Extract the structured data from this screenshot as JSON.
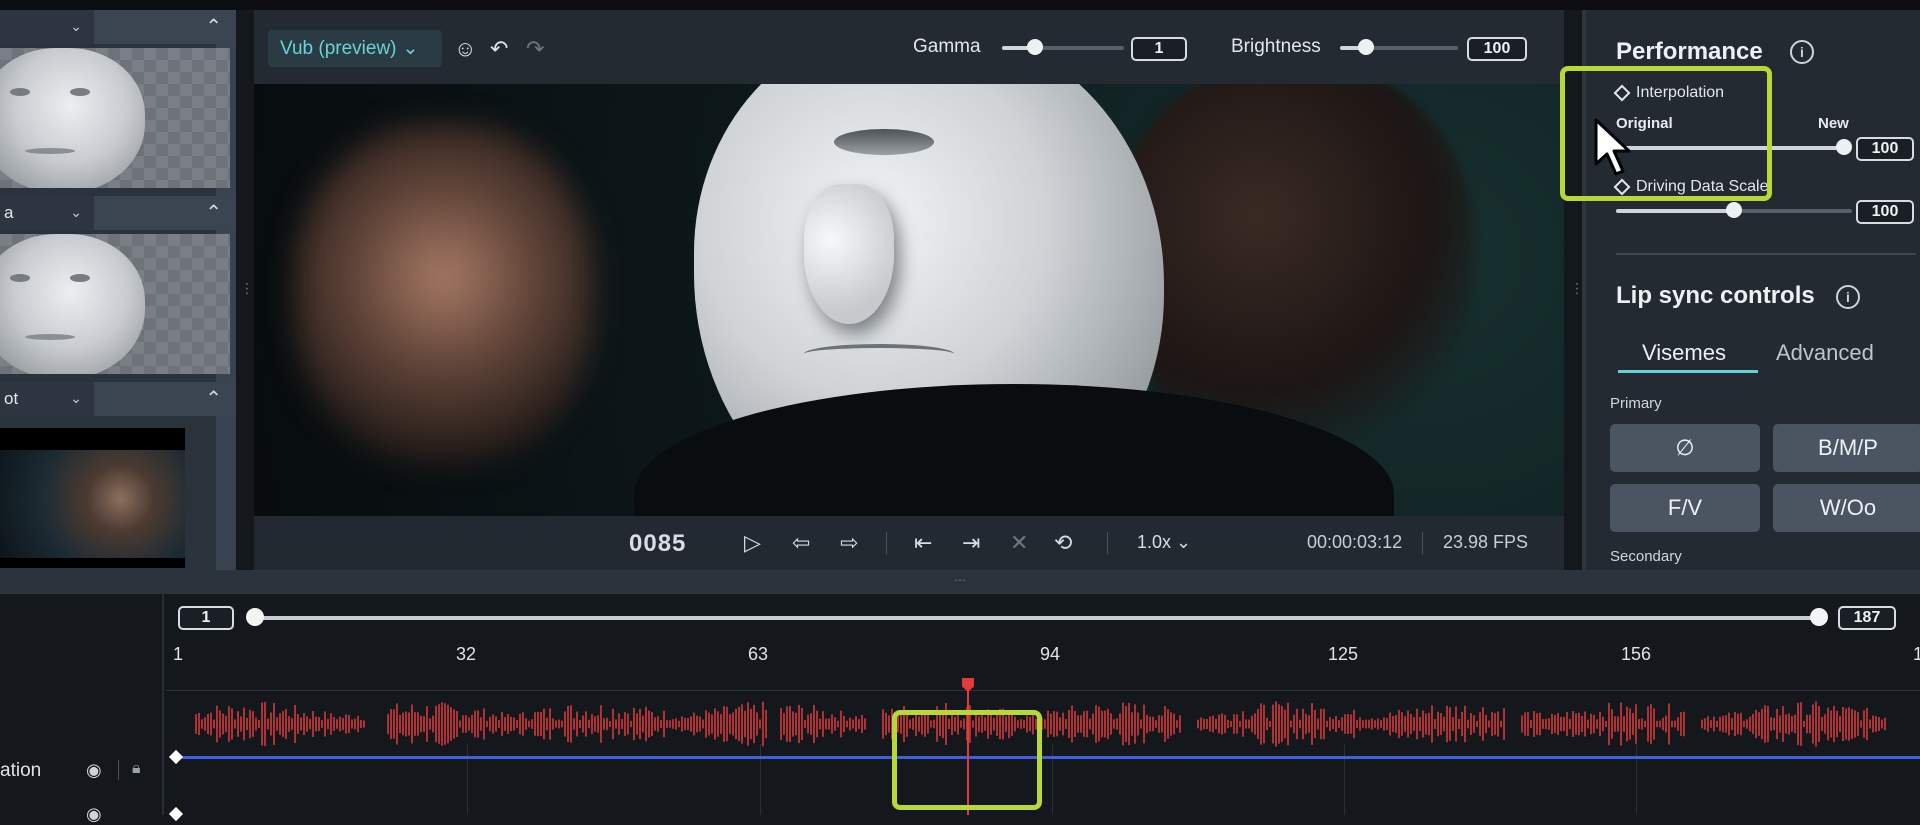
{
  "media_panel": {
    "items": [
      {
        "label": "",
        "chevron": "⌄",
        "collapse": "⌃"
      },
      {
        "label": "a",
        "chevron": "⌄",
        "collapse": "⌃"
      },
      {
        "label": "ot",
        "chevron": "⌄",
        "collapse": "⌃"
      }
    ]
  },
  "viewport": {
    "preview_select": "Vub (preview)",
    "gamma_label": "Gamma",
    "gamma_value": "1",
    "gamma_level": 0.27,
    "brightness_label": "Brightness",
    "brightness_value": "100",
    "brightness_level": 0.22
  },
  "transport": {
    "frame": "0085",
    "speed": "1.0x",
    "timecode": "00:00:03:12",
    "fps": "23.98 FPS"
  },
  "performance": {
    "title": "Performance",
    "interpolation_label": "Interpolation",
    "original_label": "Original",
    "new_label": "New",
    "interpolation_value": "100",
    "interpolation_level": 1.0,
    "driving_label": "Driving Data Scale",
    "driving_value": "100",
    "driving_level": 0.5
  },
  "lipsync": {
    "title": "Lip sync controls",
    "tab_visemes": "Visemes",
    "tab_advanced": "Advanced",
    "primary_label": "Primary",
    "secondary_label": "Secondary",
    "buttons": [
      "∅",
      "B/M/P",
      "F/V",
      "W/Oo"
    ]
  },
  "timeline": {
    "range_start": "1",
    "range_end": "187",
    "ticks": [
      "1",
      "32",
      "63",
      "94",
      "125",
      "156",
      "1"
    ],
    "track_name": "ation"
  },
  "colors": {
    "accent": "#62d0d8",
    "highlight": "#b8d83a",
    "playhead": "#e23b3b",
    "waveform": "#d23a3a",
    "keyline": "#3f5fdc"
  }
}
